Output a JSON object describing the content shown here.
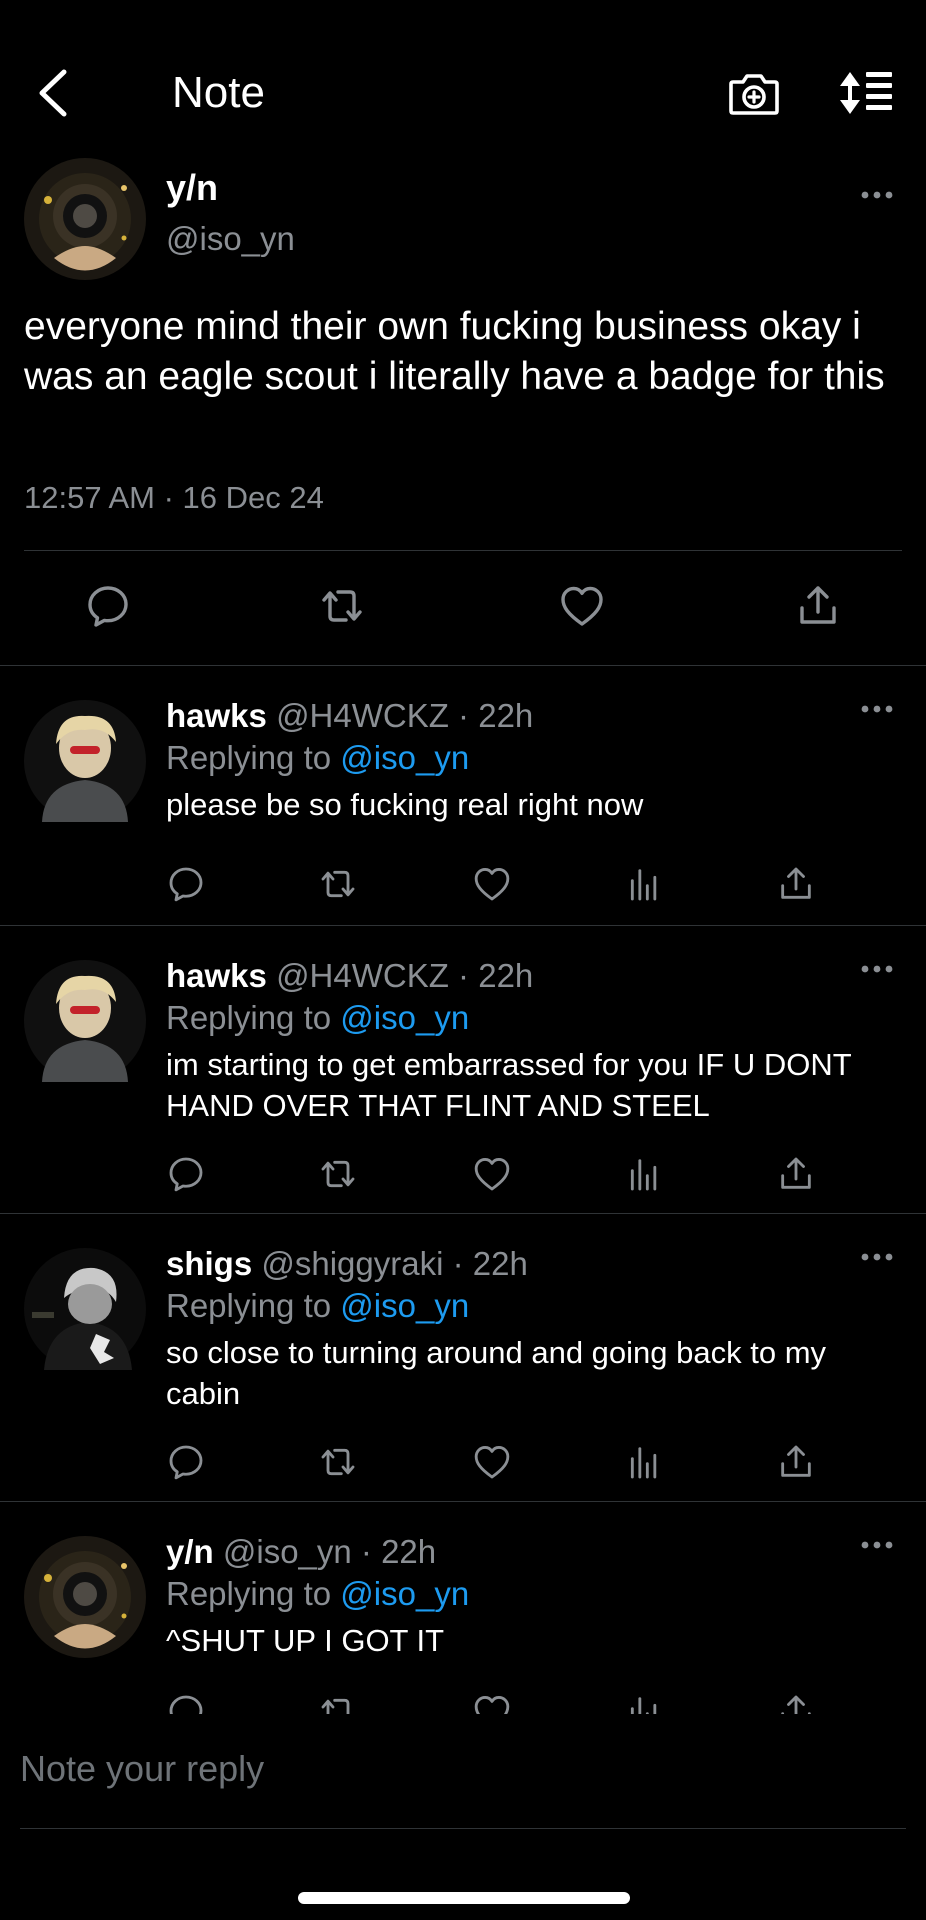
{
  "header": {
    "title": "Note",
    "icons": [
      "back-chevron-icon",
      "camera-plus-icon",
      "sort-icon"
    ]
  },
  "main_post": {
    "name": "y/n",
    "handle": "@iso_yn",
    "text": "everyone mind their own fucking business okay i was an eagle scout i literally have a badge for this",
    "timestamp": "12:57 AM · 16 Dec 24"
  },
  "replies": [
    {
      "name": "hawks",
      "meta": "@H4WCKZ · 22h",
      "replying_label": "Replying to",
      "replying_to": "@iso_yn",
      "text": "please be so fucking real right now"
    },
    {
      "name": "hawks",
      "meta": "@H4WCKZ · 22h",
      "replying_label": "Replying to",
      "replying_to": "@iso_yn",
      "text": "im starting to get embarrassed for you IF U DONT HAND OVER THAT FLINT AND STEEL"
    },
    {
      "name": "shigs",
      "meta": "@shiggyraki · 22h",
      "replying_label": "Replying to",
      "replying_to": "@iso_yn",
      "text": "so close to turning around and going back to my cabin"
    },
    {
      "name": "y/n",
      "meta": "@iso_yn · 22h",
      "replying_label": "Replying to",
      "replying_to": "@iso_yn",
      "text": "^SHUT UP I GOT IT"
    }
  ],
  "composer": {
    "placeholder": "Note your reply"
  },
  "colors": {
    "background": "#000000",
    "text": "#ffffff",
    "muted": "#8b8f94",
    "link": "#1d9bf0",
    "divider": "#2f3336"
  }
}
